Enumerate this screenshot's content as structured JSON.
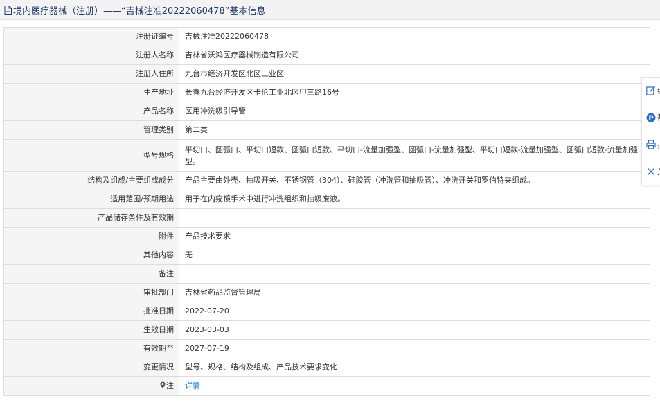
{
  "header": {
    "title": "境内医疗器械（注册）——“吉械注准20222060478”基本信息"
  },
  "rows": [
    {
      "label": "注册证编号",
      "value": "吉械注准20222060478"
    },
    {
      "label": "注册人名称",
      "value": "吉林省沃鸿医疗器械制造有限公司"
    },
    {
      "label": "注册人住所",
      "value": "九台市经济开发区北区工业区"
    },
    {
      "label": "生产地址",
      "value": "长春九台经济开发区卡伦工业北区甲三路16号"
    },
    {
      "label": "产品名称",
      "value": "医用冲洗吸引导管"
    },
    {
      "label": "管理类别",
      "value": "第二类"
    },
    {
      "label": "型号规格",
      "value": "平切口、圆弧口、平切口短款、圆弧口短款、平切口-流量加强型、圆弧口-流量加强型、平切口短款-流量加强型、圆弧口短款-流量加强型。"
    },
    {
      "label": "结构及组成/主要组成成分",
      "value": "产品主要由外壳、抽吸开关、不锈钢管（304）、硅胶管（冲洗管和抽吸管）、冲洗开关和罗伯特夹组成。"
    },
    {
      "label": "适用范围/预期用途",
      "value": "用于在内窥镜手术中进行冲洗组织和抽吸废液。"
    },
    {
      "label": "产品储存条件及有效期",
      "value": ""
    },
    {
      "label": "附件",
      "value": "产品技术要求"
    },
    {
      "label": "其他内容",
      "value": "无"
    },
    {
      "label": "备注",
      "value": ""
    },
    {
      "label": "审批部门",
      "value": "吉林省药品监督管理局"
    },
    {
      "label": "批准日期",
      "value": "2022-07-20"
    },
    {
      "label": "生效日期",
      "value": "2023-03-03"
    },
    {
      "label": "有效期至",
      "value": "2027-07-19"
    },
    {
      "label": "变更情况",
      "value": "型号、规格、结构及组成、产品技术要求变化"
    },
    {
      "label": "注",
      "value": "详情"
    }
  ],
  "side_toolbar": {
    "items": [
      {
        "icon": "edit-icon",
        "label": "编"
      },
      {
        "icon": "help-icon",
        "label": "帮"
      },
      {
        "icon": "print-icon",
        "label": "打"
      },
      {
        "icon": "close-icon",
        "label": "关"
      }
    ]
  },
  "colors": {
    "header_text": "#1f3a66",
    "link": "#2b7bd6",
    "toolbar_icon": "#2b6cc4"
  }
}
